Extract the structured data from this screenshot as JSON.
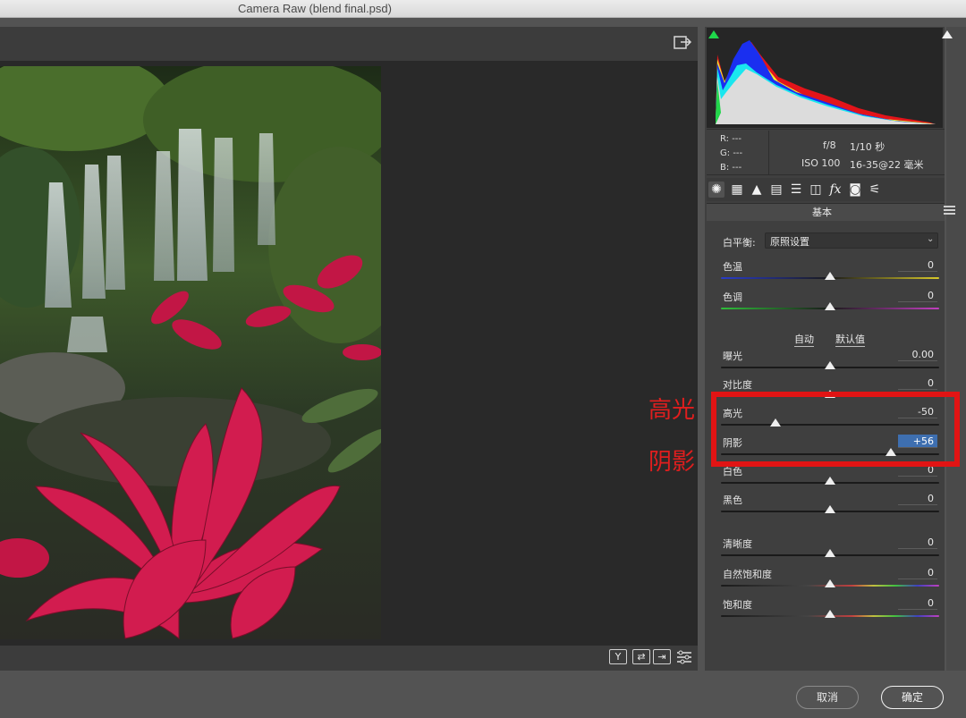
{
  "window": {
    "title": "Camera Raw (blend final.psd)"
  },
  "preview": {
    "photo_description_icon": "waterfall-photo",
    "bottom_icons": [
      "Y",
      "⇄",
      "⇥",
      "sliders-icon"
    ]
  },
  "info": {
    "r_label": "R:",
    "r_value": "---",
    "g_label": "G:",
    "g_value": "---",
    "b_label": "B:",
    "b_value": "---",
    "aperture": "f/8",
    "shutter": "1/10 秒",
    "iso": "ISO 100",
    "lens": "16-35@22 毫米"
  },
  "tabs": [
    "aperture-icon",
    "grid-icon",
    "tone-curve-icon",
    "split-icon",
    "hsl-icon",
    "lens-icon",
    "fx-icon",
    "camera-icon",
    "presets-icon"
  ],
  "panel": {
    "section_title": "基本",
    "white_balance": {
      "label": "白平衡:",
      "value": "原照设置"
    },
    "auto_label": "自动",
    "default_label": "默认值",
    "sliders": [
      {
        "label": "色温",
        "value": "0",
        "level": 0.5
      },
      {
        "label": "色调",
        "value": "0",
        "level": 0.5
      },
      {
        "label": "曝光",
        "value": "0.00",
        "level": 0.5
      },
      {
        "label": "对比度",
        "value": "0",
        "level": 0.5
      },
      {
        "label": "高光",
        "value": "-50",
        "level": 0.25
      },
      {
        "label": "阴影",
        "value": "+56",
        "level": 0.78
      },
      {
        "label": "白色",
        "value": "0",
        "level": 0.5
      },
      {
        "label": "黑色",
        "value": "0",
        "level": 0.5
      },
      {
        "label": "清晰度",
        "value": "0",
        "level": 0.5
      },
      {
        "label": "自然饱和度",
        "value": "0",
        "level": 0.5
      },
      {
        "label": "饱和度",
        "value": "0",
        "level": 0.5
      }
    ]
  },
  "annotations": {
    "highlights": "高光",
    "shadows": "阴影"
  },
  "buttons": {
    "cancel": "取消",
    "ok": "确定"
  },
  "colors": {
    "annotation_red": "#e11414",
    "selected_field": "#3e6fb0"
  }
}
